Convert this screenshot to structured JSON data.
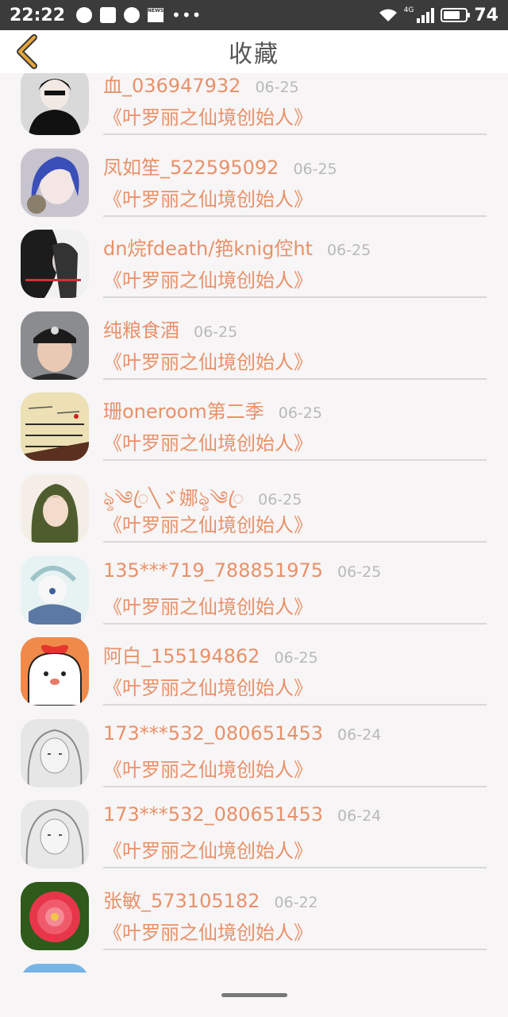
{
  "status_bar": {
    "time": "22:22",
    "network": "4G",
    "battery": "74",
    "battery_level": 0.74
  },
  "header": {
    "title": "收藏",
    "back_icon": "chevron-left-icon",
    "accent_color": "#e8a63a"
  },
  "colors": {
    "name": "#e8916a",
    "date": "#b9b9b9",
    "divider": "#d8d8d8"
  },
  "favorites": [
    {
      "name": "血_036947932",
      "date": "06-25",
      "title": "《叶罗丽之仙境创始人》"
    },
    {
      "name": "凤如笙_522595092",
      "date": "06-25",
      "title": "《叶罗丽之仙境创始人》"
    },
    {
      "name": "dn烷fdeath/筢knig倥ht",
      "date": "06-25",
      "title": "《叶罗丽之仙境创始人》"
    },
    {
      "name": "纯粮食酒",
      "date": "06-25",
      "title": "《叶罗丽之仙境创始人》"
    },
    {
      "name": "珊oneroom第二季",
      "date": "06-25",
      "title": "《叶罗丽之仙境创始人》"
    },
    {
      "name": "ৡ༄ꦿ╲ゞ娜ৡ༄ꦿ",
      "date": "06-25",
      "title": "《叶罗丽之仙境创始人》"
    },
    {
      "name": "135***719_788851975",
      "date": "06-25",
      "title": "《叶罗丽之仙境创始人》"
    },
    {
      "name": "阿白_155194862",
      "date": "06-25",
      "title": "《叶罗丽之仙境创始人》"
    },
    {
      "name": "173***532_080651453",
      "date": "06-24",
      "title": "《叶罗丽之仙境创始人》"
    },
    {
      "name": "173***532_080651453",
      "date": "06-24",
      "title": "《叶罗丽之仙境创始人》"
    },
    {
      "name": "张敏_573105182",
      "date": "06-22",
      "title": "《叶罗丽之仙境创始人》"
    }
  ]
}
